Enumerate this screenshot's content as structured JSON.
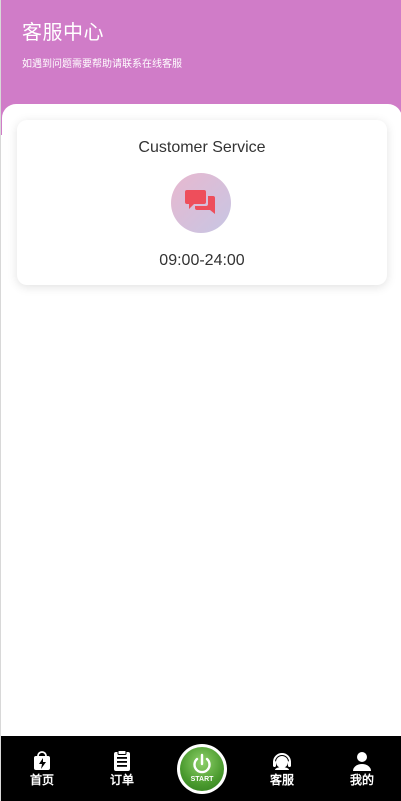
{
  "header": {
    "title": "客服中心",
    "subtitle": "如遇到问题需要帮助请联系在线客服"
  },
  "card": {
    "title": "Customer Service",
    "icon": "chat-bubbles-icon",
    "hours": "09:00-24:00"
  },
  "tabbar": {
    "items": [
      {
        "label": "首页",
        "icon": "home-bag-icon"
      },
      {
        "label": "订单",
        "icon": "order-list-icon"
      },
      {
        "label": "客服",
        "icon": "headset-icon"
      },
      {
        "label": "我的",
        "icon": "user-icon"
      }
    ],
    "start": {
      "label": "START",
      "icon": "power-icon"
    }
  },
  "colors": {
    "header_bg": "#d07cc8",
    "chat_icon": "#ee4e5b",
    "tabbar_bg": "#000000",
    "start_green": "#4a9a2e"
  }
}
